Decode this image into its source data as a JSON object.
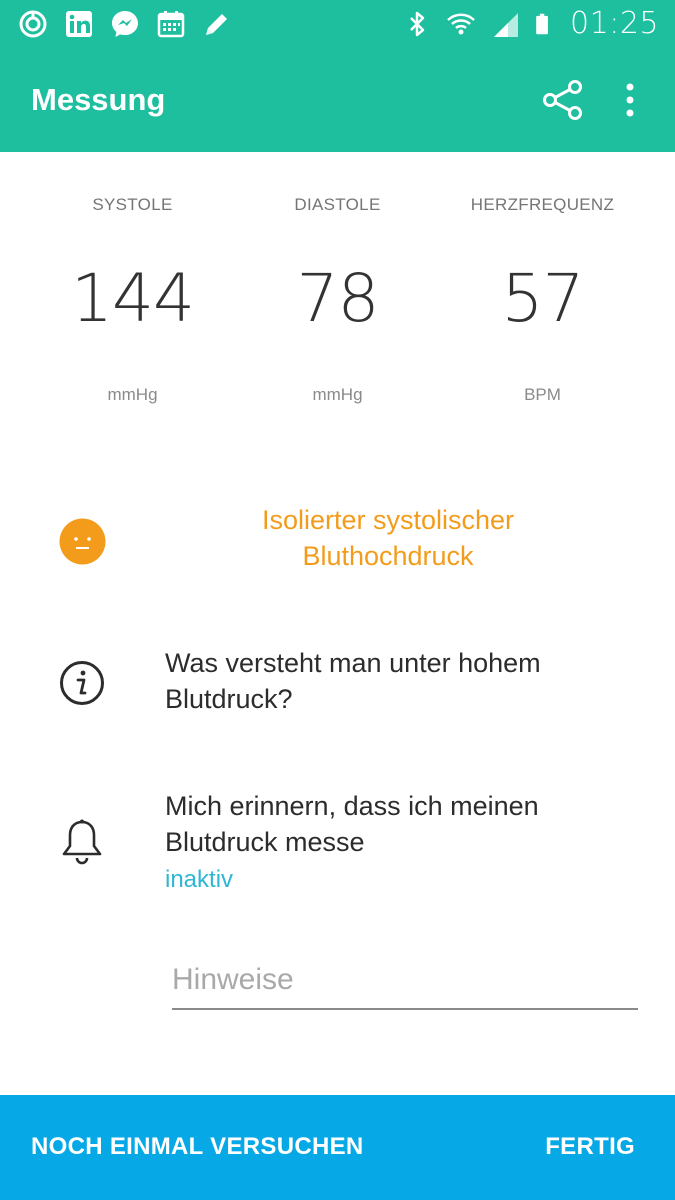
{
  "status_bar": {
    "time": "01:25",
    "left_icons": [
      "sync-icon",
      "linkedin-icon",
      "messenger-icon",
      "calendar-icon",
      "pencil-icon"
    ],
    "right_icons": [
      "bluetooth-icon",
      "wifi-icon",
      "signal-icon",
      "battery-icon"
    ]
  },
  "app_bar": {
    "title": "Messung",
    "color": "#1dbf9f",
    "actions": [
      "share-icon",
      "more-vert-icon"
    ]
  },
  "vitals": {
    "systole": {
      "label": "SYSTOLE",
      "value": "144",
      "unit": "mmHg"
    },
    "diastole": {
      "label": "DIASTOLE",
      "value": "78",
      "unit": "mmHg"
    },
    "heart_rate": {
      "label": "HERZFREQUENZ",
      "value": "57",
      "unit": "BPM"
    }
  },
  "diagnosis": {
    "text_line1": "Isolierter systolischer",
    "text_line2": "Bluthochdruck",
    "color": "#f39c1c",
    "icon": "neutral-face-icon"
  },
  "info_link": {
    "line1": "Was versteht man unter hohem",
    "line2": "Blutdruck?",
    "icon": "info-icon"
  },
  "reminder": {
    "line1": "Mich erinnern, dass ich meinen",
    "line2": "Blutdruck messe",
    "status": "inaktiv",
    "status_color": "#2fb6d6",
    "icon": "bell-icon"
  },
  "notes": {
    "placeholder": "Hinweise",
    "value": ""
  },
  "bottom_bar": {
    "color": "#06a9e5",
    "retry_label": "NOCH EINMAL VERSUCHEN",
    "done_label": "FERTIG"
  }
}
